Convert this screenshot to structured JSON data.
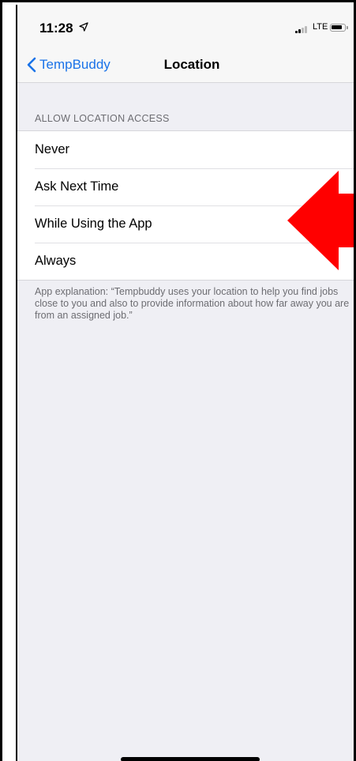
{
  "status_bar": {
    "time": "11:28",
    "carrier": "LTE",
    "icons": [
      "location-arrow-icon",
      "signal-bars-icon",
      "battery-icon"
    ]
  },
  "nav": {
    "back_label": "TempBuddy",
    "title": "Location"
  },
  "section": {
    "header": "ALLOW LOCATION ACCESS",
    "options": [
      {
        "label": "Never"
      },
      {
        "label": "Ask Next Time"
      },
      {
        "label": "While Using the App"
      },
      {
        "label": "Always"
      }
    ],
    "footer": "App explanation: “Tempbuddy uses your location to help you find jobs close to you and also to provide information about how far away you are from an assigned job.”"
  },
  "colors": {
    "accent": "#1a73e8",
    "annotation_arrow": "#ff0000",
    "grouped_background": "#efeff4"
  }
}
